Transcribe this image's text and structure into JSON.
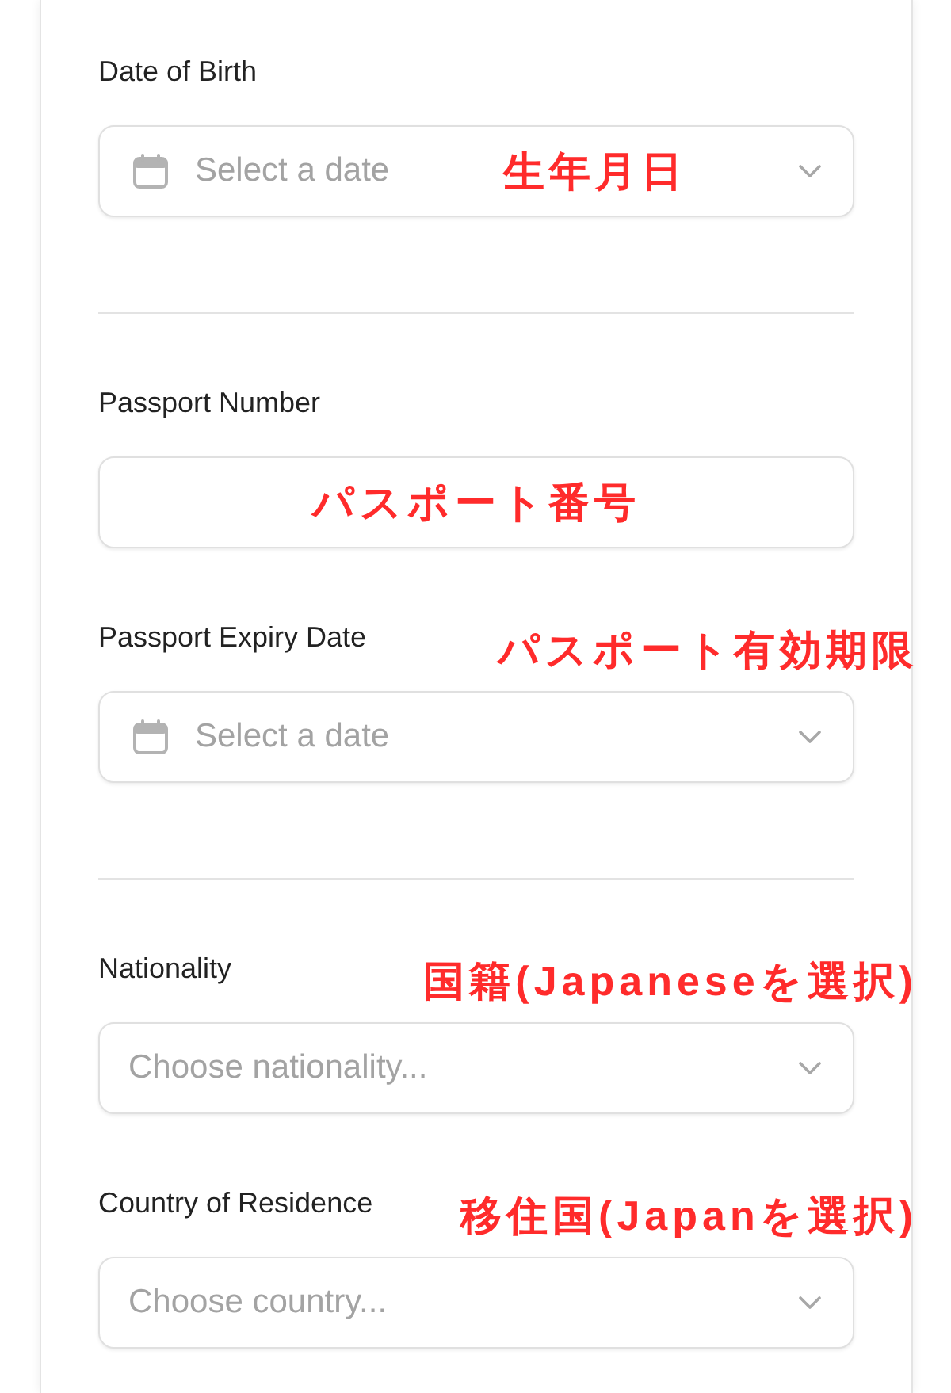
{
  "sections": [
    {
      "fields": [
        {
          "kind": "date",
          "label": "Date of Birth",
          "placeholder": "Select a date",
          "annotation": {
            "text": "生年月日",
            "kind": "in_field"
          }
        }
      ]
    },
    {
      "fields": [
        {
          "kind": "text",
          "label": "Passport Number",
          "annotation": {
            "text": "パスポート番号",
            "kind": "in_field"
          }
        },
        {
          "kind": "date",
          "label": "Passport Expiry Date",
          "placeholder": "Select a date",
          "annotation": {
            "text": "パスポート有効期限",
            "kind": "beside_label"
          }
        }
      ]
    },
    {
      "fields": [
        {
          "kind": "select",
          "label": "Nationality",
          "placeholder": "Choose nationality...",
          "annotation": {
            "text": "国籍(Japaneseを選択)",
            "kind": "beside_label"
          }
        },
        {
          "kind": "select",
          "label": "Country of Residence",
          "placeholder": "Choose country...",
          "annotation": {
            "text": "移住国(Japanを選択)",
            "kind": "beside_label"
          }
        }
      ]
    }
  ]
}
